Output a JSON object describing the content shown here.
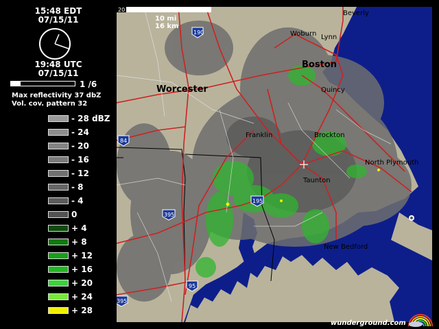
{
  "panel": {
    "local_time": "15:48 EDT",
    "local_date": "07/15/11",
    "utc_time": "19:48 UTC",
    "utc_date": "07/15/11",
    "frame_label": "1 /6",
    "animation_progress": 0.16,
    "max_reflectivity": "Max reflectivity 37 dbZ",
    "vcp": "Vol. cov. pattern 32"
  },
  "legend": [
    {
      "label": "- 28 dBZ",
      "color": "#9a9a9a"
    },
    {
      "label": "- 24",
      "color": "#8e8e8e"
    },
    {
      "label": "- 20",
      "color": "#848484"
    },
    {
      "label": "- 16",
      "color": "#7a7a7a"
    },
    {
      "label": "- 12",
      "color": "#707070"
    },
    {
      "label": "- 8",
      "color": "#666666"
    },
    {
      "label": "- 4",
      "color": "#5c5c5c"
    },
    {
      "label": "0",
      "color": "#525252"
    },
    {
      "label": "+ 4",
      "color": "#0d4d0d"
    },
    {
      "label": "+ 8",
      "color": "#127a12"
    },
    {
      "label": "+ 12",
      "color": "#17a017"
    },
    {
      "label": "+ 16",
      "color": "#20b820"
    },
    {
      "label": "+ 20",
      "color": "#3cd23c"
    },
    {
      "label": "+ 24",
      "color": "#78e83c"
    },
    {
      "label": "+ 28",
      "color": "#f0f000"
    }
  ],
  "scale": {
    "mi": "10 mi",
    "km": "16 km",
    "bar_label": "20"
  },
  "cities": {
    "beverly": "Beverly",
    "woburn": "Woburn",
    "lynn": "Lynn",
    "boston": "Boston",
    "quincy": "Quincy",
    "worcester": "Worcester",
    "franklin": "Franklin",
    "brockton": "Brockton",
    "north_plymouth": "North Plymouth",
    "taunton": "Taunton",
    "new_bedford": "New Bedford"
  },
  "shields": {
    "i190": "190",
    "i84": "84",
    "i395a": "395",
    "i195": "195",
    "i95": "95",
    "i395b": "395"
  },
  "credit": "wunderground.com",
  "colors": {
    "land": "#b9b39c",
    "water": "#0d1e8a",
    "roads": "#cc2222",
    "echo_gray": "#6e6e6e",
    "echo_green": "#2fb52f"
  }
}
